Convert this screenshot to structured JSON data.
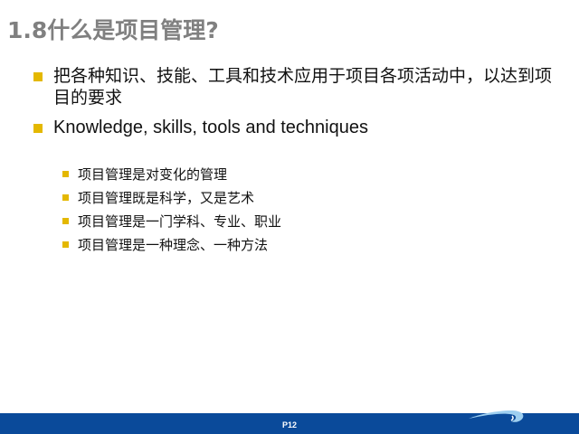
{
  "slide": {
    "title": "1.8什么是项目管理?",
    "bullets": [
      {
        "text": "把各种知识、技能、工具和技术应用于项目各项活动中，以达到项目的要求"
      },
      {
        "text": "Knowledge, skills, tools and techniques"
      }
    ],
    "sub_bullets": [
      {
        "text": "项目管理是对变化的管理"
      },
      {
        "text": "项目管理既是科学，又是艺术"
      },
      {
        "text": "项目管理是一门学科、专业、职业"
      },
      {
        "text": "项目管理是一种理念、一种方法"
      }
    ],
    "page_number": "P12"
  },
  "colors": {
    "title": "#808080",
    "bullet": "#e4b800",
    "footer": "#0a4a9a",
    "accent_light": "#9ecff0"
  }
}
